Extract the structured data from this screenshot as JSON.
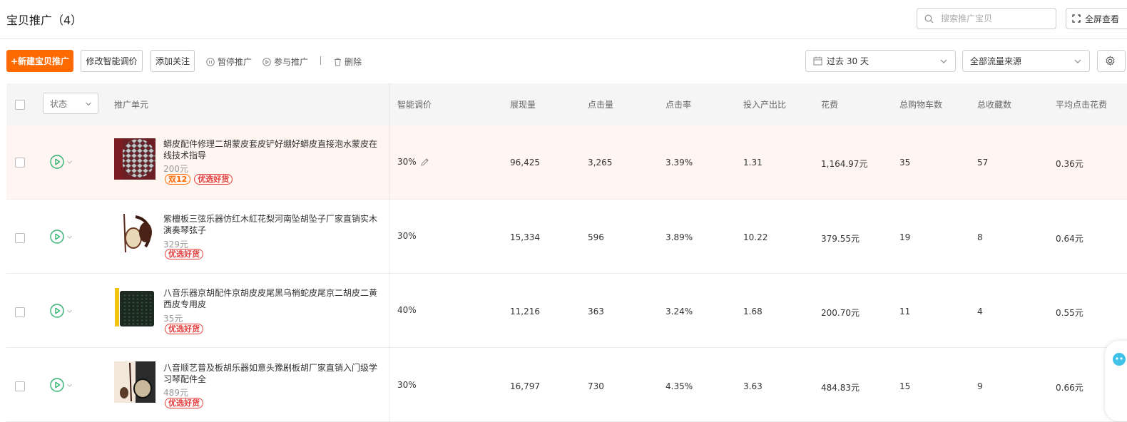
{
  "header": {
    "title": "宝贝推广（4）",
    "search_placeholder": "搜索推广宝贝",
    "fullscreen_label": "全屏查看"
  },
  "toolbar": {
    "new_label": "+新建宝贝推广",
    "modify_label": "修改智能调价",
    "follow_label": "添加关注",
    "pause_label": "暂停推广",
    "join_label": "参与推广",
    "delete_label": "删除",
    "date_range": "过去 30 天",
    "traffic_source": "全部流量来源"
  },
  "table": {
    "status_filter": "状态",
    "columns": [
      "推广单元",
      "智能调价",
      "展现量",
      "点击量",
      "点击率",
      "投入产出比",
      "花费",
      "总购物车数",
      "总收藏数",
      "平均点击花费"
    ],
    "rows": [
      {
        "name": "蟒皮配件修理二胡蒙皮套皮铲好绷好蟒皮直接泡水蒙皮在线技术指导",
        "price": "200元",
        "tags": [
          "双12",
          "优选好货"
        ],
        "smart_price": "30%",
        "impressions": "96,425",
        "clicks": "3,265",
        "ctr": "3.39%",
        "roi": "1.31",
        "cost": "1,164.97元",
        "cart": "35",
        "fav": "57",
        "cpc": "0.36元"
      },
      {
        "name": "紫檀板三弦乐器仿红木紅花梨河南坠胡坠子厂家直销实木演奏琴弦子",
        "price": "329元",
        "tags": [
          "优选好货"
        ],
        "smart_price": "30%",
        "impressions": "15,334",
        "clicks": "596",
        "ctr": "3.89%",
        "roi": "10.22",
        "cost": "379.55元",
        "cart": "19",
        "fav": "8",
        "cpc": "0.64元"
      },
      {
        "name": "八音乐器京胡配件京胡皮皮尾黑乌梢蛇皮尾京二胡皮二黄西皮专用皮",
        "price": "35元",
        "tags": [
          "优选好货"
        ],
        "smart_price": "40%",
        "impressions": "11,216",
        "clicks": "363",
        "ctr": "3.24%",
        "roi": "1.68",
        "cost": "200.70元",
        "cart": "11",
        "fav": "4",
        "cpc": "0.55元"
      },
      {
        "name": "八音顺艺普及板胡乐器如意头豫剧板胡厂家直销入门级学习琴配件全",
        "price": "489元",
        "tags": [
          "优选好货"
        ],
        "smart_price": "30%",
        "impressions": "16,797",
        "clicks": "730",
        "ctr": "4.35%",
        "roi": "3.63",
        "cost": "484.83元",
        "cart": "15",
        "fav": "9",
        "cpc": "0.66元"
      }
    ]
  },
  "colors": {
    "brand_orange": "#ff6a00",
    "tag_red": "#e43d3d",
    "play_green": "#2fb36f",
    "highlight_row": "#fff6f1"
  }
}
